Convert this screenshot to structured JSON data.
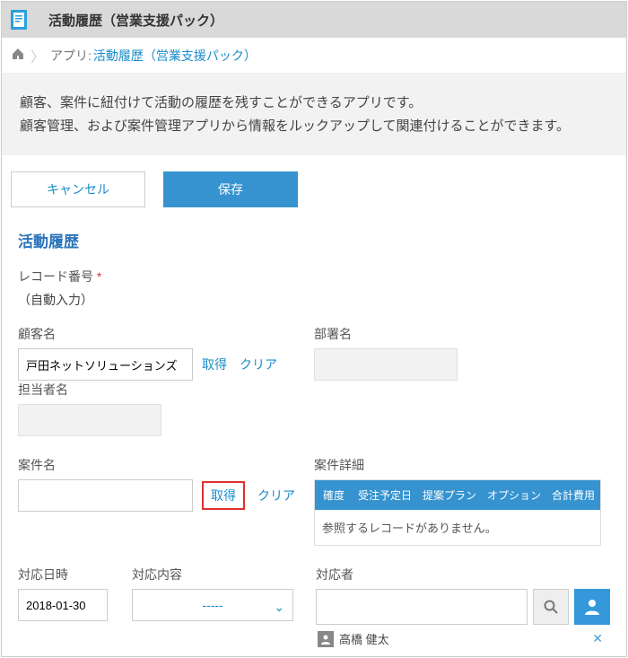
{
  "header": {
    "title": "活動履歴（営業支援パック）"
  },
  "breadcrumb": {
    "prefix": "アプリ:",
    "app_name": "活動履歴（営業支援パック）"
  },
  "description": {
    "line1": "顧客、案件に紐付けて活動の履歴を残すことができるアプリです。",
    "line2": "顧客管理、および案件管理アプリから情報をルックアップして関連付けることができます。"
  },
  "actions": {
    "cancel": "キャンセル",
    "save": "保存"
  },
  "form": {
    "section_title": "活動履歴",
    "record_no": {
      "label": "レコード番号",
      "auto_text": "（自動入力）"
    },
    "customer": {
      "label": "顧客名",
      "value": "戸田ネットソリューションズ",
      "fetch": "取得",
      "clear": "クリア"
    },
    "department": {
      "label": "部署名"
    },
    "contact": {
      "label": "担当者名"
    },
    "project": {
      "label": "案件名",
      "value": "",
      "fetch": "取得",
      "clear": "クリア"
    },
    "project_detail": {
      "label": "案件詳細",
      "columns": [
        "確度",
        "受注予定日",
        "提案プラン",
        "オプション",
        "合計費用"
      ],
      "empty_text": "参照するレコードがありません。"
    },
    "response_date": {
      "label": "対応日時",
      "value": "2018-01-30"
    },
    "response_type": {
      "label": "対応内容",
      "value": "-----"
    },
    "responder": {
      "label": "対応者",
      "selected_user": "高橋 健太"
    }
  }
}
